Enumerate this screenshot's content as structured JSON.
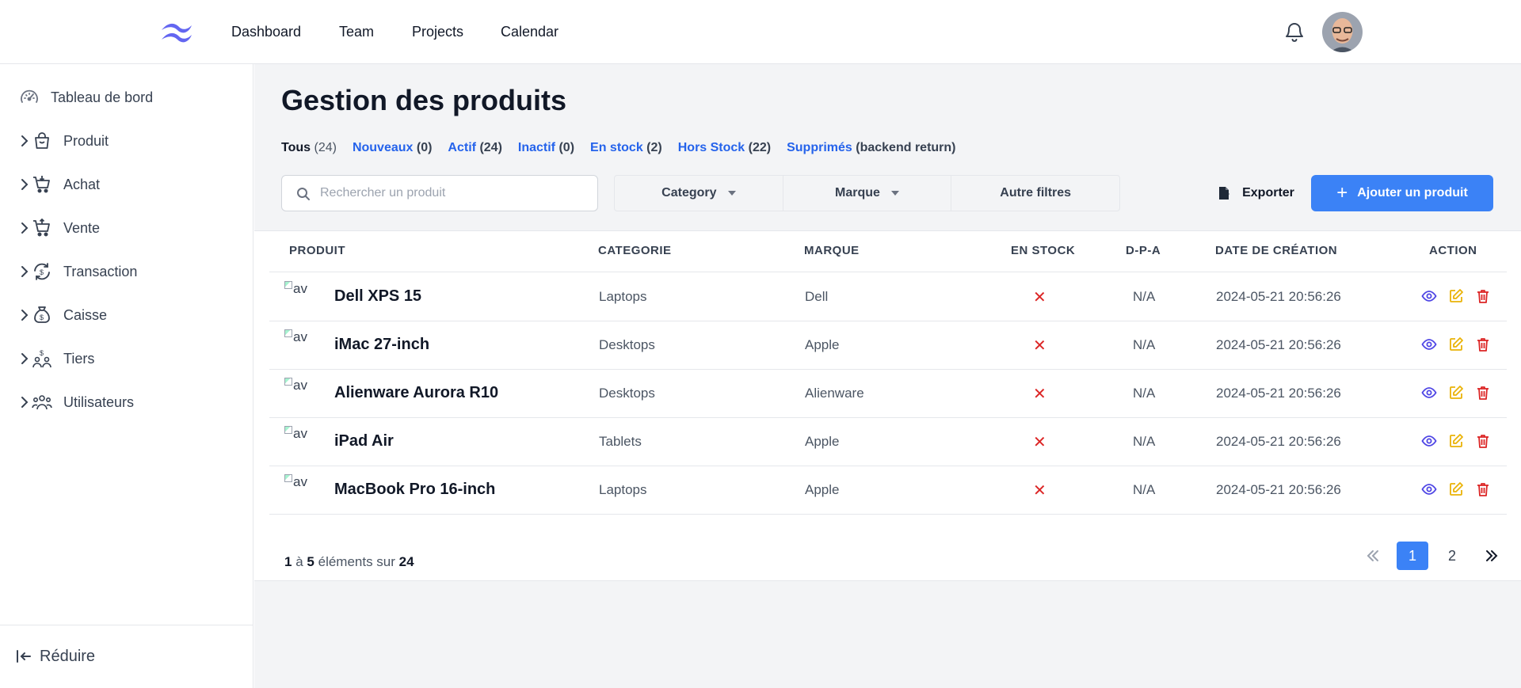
{
  "topnav": {
    "links": [
      "Dashboard",
      "Team",
      "Projects",
      "Calendar"
    ]
  },
  "sidebar": {
    "items": [
      {
        "label": "Tableau de bord",
        "icon": "speedometer-icon"
      },
      {
        "label": "Produit",
        "icon": "shopping-bag-icon"
      },
      {
        "label": "Achat",
        "icon": "cart-icon"
      },
      {
        "label": "Vente",
        "icon": "cart-icon"
      },
      {
        "label": "Transaction",
        "icon": "exchange-icon"
      },
      {
        "label": "Caisse",
        "icon": "money-bag-icon"
      },
      {
        "label": "Tiers",
        "icon": "group-dollar-icon"
      },
      {
        "label": "Utilisateurs",
        "icon": "users-icon"
      }
    ],
    "collapse_label": "Réduire"
  },
  "main": {
    "title": "Gestion des produits",
    "filter_tabs": [
      {
        "label": "Tous",
        "count": "(24)"
      },
      {
        "label": "Nouveaux",
        "count": "(0)"
      },
      {
        "label": "Actif",
        "count": "(24)"
      },
      {
        "label": "Inactif",
        "count": "(0)"
      },
      {
        "label": "En stock",
        "count": "(2)"
      },
      {
        "label": "Hors Stock",
        "count": "(22)"
      },
      {
        "label": "Supprimés",
        "count": "(backend return)"
      }
    ],
    "search_placeholder": "Rechercher un produit",
    "filters": {
      "category": "Category",
      "brand": "Marque",
      "other": "Autre filtres"
    },
    "export_label": "Exporter",
    "add_label": "Ajouter un produit"
  },
  "table": {
    "headers": [
      "PRODUIT",
      "CATEGORIE",
      "MARQUE",
      "EN STOCK",
      "D-P-A",
      "DATE DE CRÉATION",
      "ACTION"
    ],
    "image_alt": "av",
    "rows": [
      {
        "name": "Dell XPS 15",
        "category": "Laptops",
        "brand": "Dell",
        "in_stock": "✕",
        "dpa": "N/A",
        "created": "2024-05-21 20:56:26"
      },
      {
        "name": "iMac 27-inch",
        "category": "Desktops",
        "brand": "Apple",
        "in_stock": "✕",
        "dpa": "N/A",
        "created": "2024-05-21 20:56:26"
      },
      {
        "name": "Alienware Aurora R10",
        "category": "Desktops",
        "brand": "Alienware",
        "in_stock": "✕",
        "dpa": "N/A",
        "created": "2024-05-21 20:56:26"
      },
      {
        "name": "iPad Air",
        "category": "Tablets",
        "brand": "Apple",
        "in_stock": "✕",
        "dpa": "N/A",
        "created": "2024-05-21 20:56:26"
      },
      {
        "name": "MacBook Pro 16-inch",
        "category": "Laptops",
        "brand": "Apple",
        "in_stock": "✕",
        "dpa": "N/A",
        "created": "2024-05-21 20:56:26"
      }
    ]
  },
  "pagination": {
    "from": "1",
    "sep1": "à",
    "to": "5",
    "sep2": "éléments sur",
    "total": "24",
    "pages": [
      "1",
      "2"
    ]
  },
  "colors": {
    "accent": "#3b82f6",
    "link": "#2563eb",
    "danger": "#dc2626",
    "warning": "#eab308",
    "view": "#4f46e5"
  }
}
